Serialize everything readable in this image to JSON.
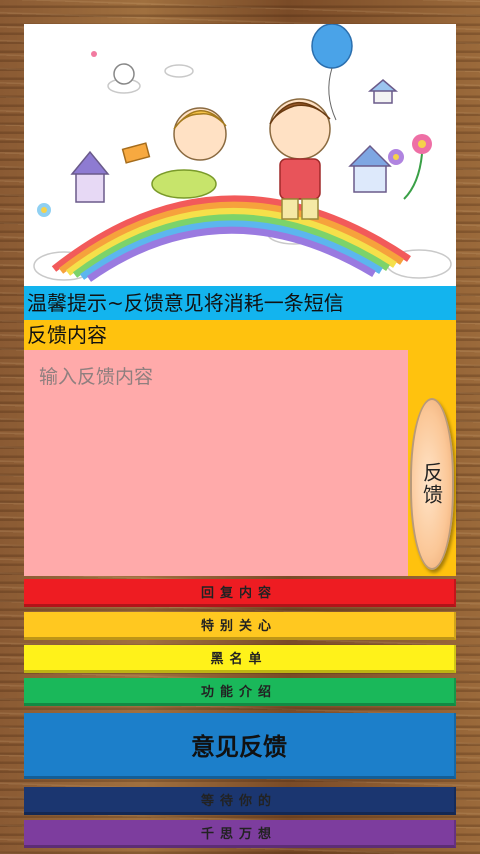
{
  "tip": {
    "text": "温馨提示~反馈意见将消耗一条短信"
  },
  "feedback": {
    "label": "反馈内容",
    "placeholder": "输入反馈内容",
    "button": "反馈"
  },
  "menu": [
    {
      "label": "回复内容",
      "color": "#ee1c22"
    },
    {
      "label": "特别关心",
      "color": "#ffc820"
    },
    {
      "label": "黑名单",
      "color": "#fff21a"
    },
    {
      "label": "功能介绍",
      "color": "#1ab85a"
    },
    {
      "label": "意见反馈",
      "color": "#1c7fca"
    },
    {
      "label": "等待你的",
      "color": "#1b3670"
    },
    {
      "label": "千思万想",
      "color": "#7d3d9e"
    }
  ]
}
